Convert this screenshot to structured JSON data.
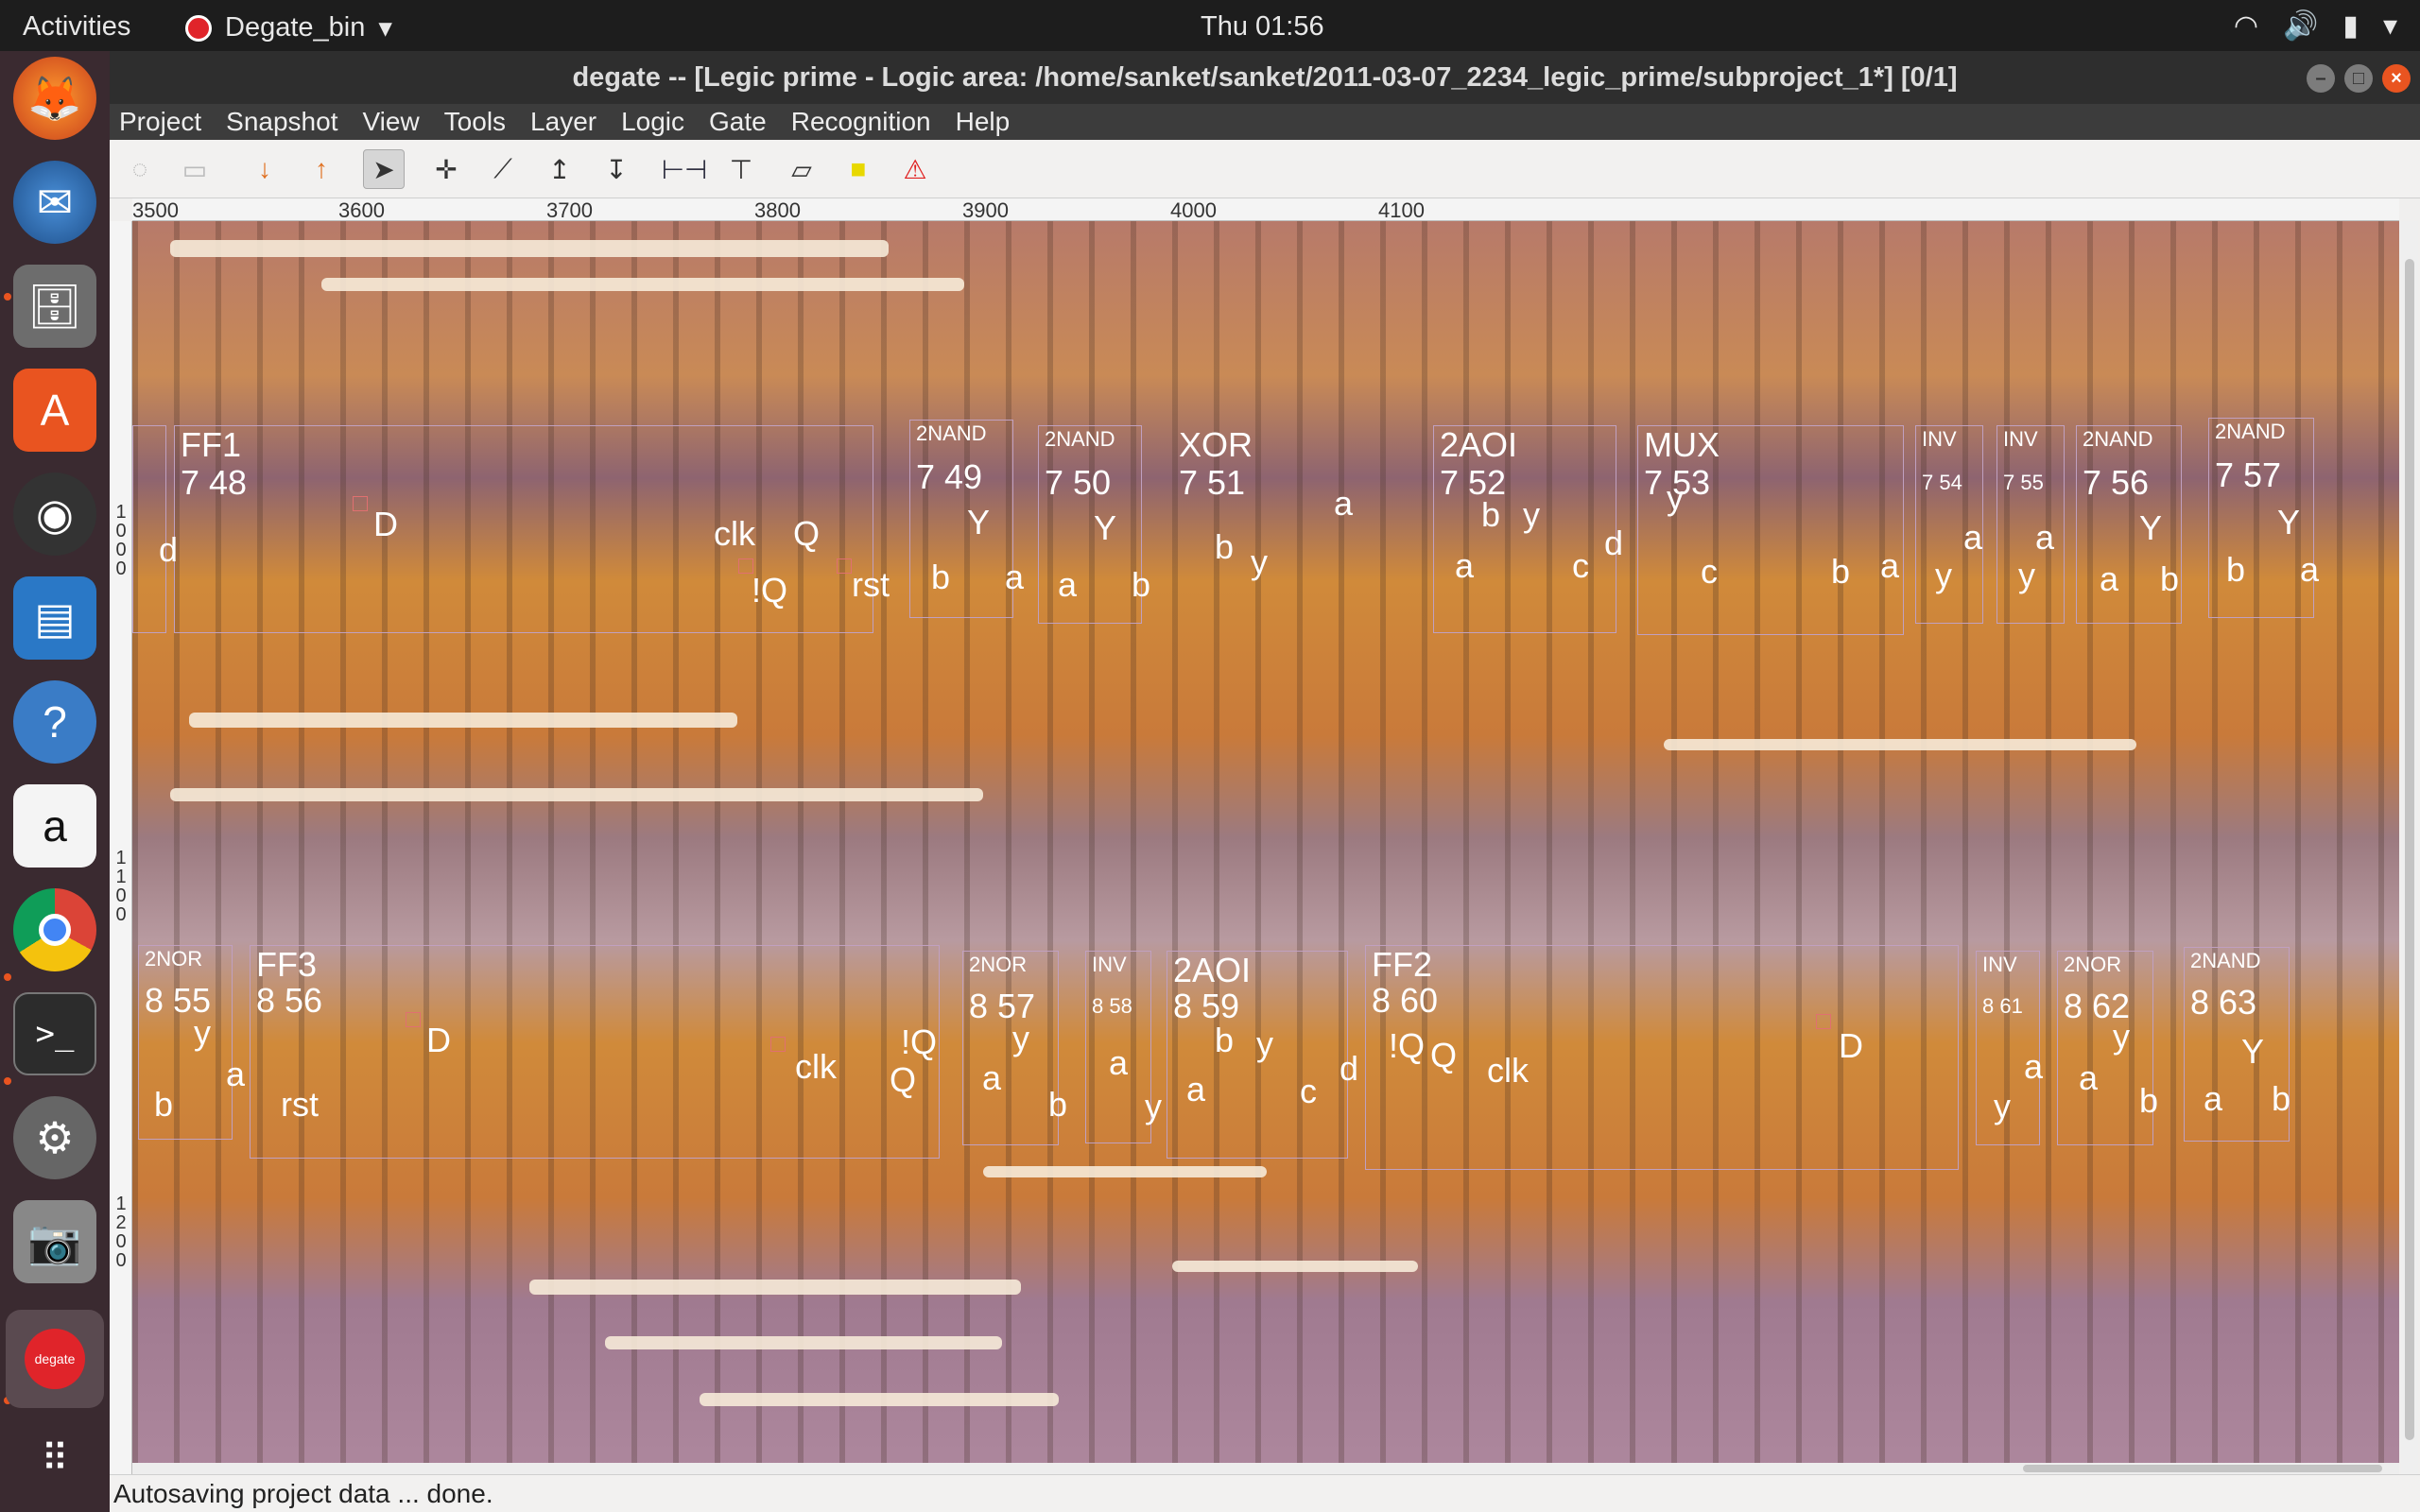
{
  "topbar": {
    "activities": "Activities",
    "app_name": "Degate_bin",
    "clock": "Thu 01:56"
  },
  "dock": {
    "items": [
      "firefox-icon",
      "thunderbird-icon",
      "files-icon",
      "software-center-icon",
      "rhythmbox-icon",
      "libreoffice-impress-icon",
      "help-icon",
      "amazon-icon",
      "chrome-icon",
      "terminal-icon",
      "settings-icon",
      "screenshot-icon",
      "degate-icon",
      "app-grid-icon"
    ],
    "degate_label": "degate"
  },
  "window": {
    "title": "degate -- [Legic prime - Logic area: /home/sanket/sanket/2011-03-07_2234_legic_prime/subproject_1*] [0/1]"
  },
  "menubar": [
    "Project",
    "Snapshot",
    "View",
    "Tools",
    "Layer",
    "Logic",
    "Gate",
    "Recognition",
    "Help"
  ],
  "ruler": {
    "h_labels": [
      "3500",
      "3600",
      "3700",
      "3800",
      "3900",
      "4000",
      "4100"
    ],
    "v_labels_1": [
      "1",
      "0",
      "0",
      "0"
    ],
    "v_labels_2": [
      "1",
      "1",
      "0",
      "0"
    ],
    "v_labels_3": [
      "1",
      "2",
      "0",
      "0"
    ]
  },
  "gates_top": [
    {
      "type": "FF1",
      "num": "7 48",
      "ports": [
        "D",
        "clk",
        "Q",
        "!Q",
        "rst",
        "d"
      ]
    },
    {
      "type": "2NAND",
      "num": "7 49",
      "ports": [
        "Y",
        "b",
        "a"
      ]
    },
    {
      "type": "2NAND",
      "num": "7 50",
      "ports": [
        "Y",
        "a",
        "b"
      ]
    },
    {
      "type": "XOR",
      "num": "7 51",
      "ports": [
        "a",
        "b",
        "y"
      ]
    },
    {
      "type": "2AOI",
      "num": "7 52",
      "ports": [
        "b",
        "y",
        "a",
        "c",
        "d"
      ]
    },
    {
      "type": "MUX",
      "num": "7 53",
      "ports": [
        "y",
        "c",
        "b",
        "a"
      ]
    },
    {
      "type": "INV",
      "num": "7 54",
      "ports": [
        "a",
        "y"
      ]
    },
    {
      "type": "INV",
      "num": "7 55",
      "ports": [
        "a",
        "y"
      ]
    },
    {
      "type": "2NAND",
      "num": "7 56",
      "ports": [
        "Y",
        "a",
        "b"
      ]
    },
    {
      "type": "2NAND",
      "num": "7 57",
      "ports": [
        "Y",
        "b",
        "a"
      ]
    }
  ],
  "gates_bottom": [
    {
      "type": "2NOR",
      "num": "8 55",
      "ports": [
        "y",
        "a",
        "b"
      ]
    },
    {
      "type": "FF3",
      "num": "8 56",
      "ports": [
        "D",
        "rst",
        "clk",
        "Q",
        "!Q"
      ]
    },
    {
      "type": "2NOR",
      "num": "8 57",
      "ports": [
        "y",
        "a",
        "b"
      ]
    },
    {
      "type": "INV",
      "num": "8 58",
      "ports": [
        "a",
        "y"
      ]
    },
    {
      "type": "2AOI",
      "num": "8 59",
      "ports": [
        "b",
        "y",
        "a",
        "c",
        "d"
      ]
    },
    {
      "type": "FF2",
      "num": "8 60",
      "ports": [
        "!Q",
        "Q",
        "clk",
        "D"
      ]
    },
    {
      "type": "INV",
      "num": "8 61",
      "ports": [
        "a",
        "y"
      ]
    },
    {
      "type": "2NOR",
      "num": "8 62",
      "ports": [
        "y",
        "a",
        "b"
      ]
    },
    {
      "type": "2NAND",
      "num": "8 63",
      "ports": [
        "Y",
        "a",
        "b"
      ]
    }
  ],
  "status": "Autosaving project data ... done."
}
